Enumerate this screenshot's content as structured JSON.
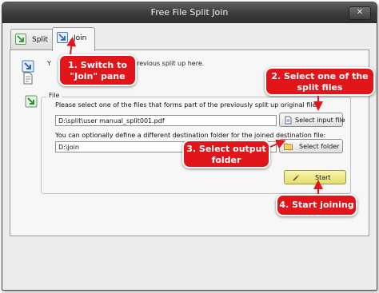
{
  "window": {
    "title": "Free File Split Join",
    "close_symbol": "✕"
  },
  "tabs": [
    {
      "label": "Split",
      "icon": "split-arrow-icon"
    },
    {
      "label": "Join",
      "icon": "join-arrow-icon"
    }
  ],
  "pane": {
    "intro_start": "Y",
    "intro_end": "revious split up here.",
    "group_title": "File",
    "select_desc": "Please select one of the files that forms part of the previously split up original file.",
    "input_file_value": "D:\\split\\user manual_split001.pdf",
    "select_input_label": "Select input file",
    "folder_desc": "You can optionally define a different destination folder for the joined destination file:",
    "output_folder_value": "D:\\join",
    "select_folder_label": "Select folder",
    "start_label": "Start"
  },
  "callouts": {
    "switch_tab": "1. Switch to \"Join\" pane",
    "select_file": "2. Select one of the split files",
    "output_folder": "3. Select output folder",
    "start": "4. Start joining"
  },
  "colors": {
    "callout_red": "#e0161b",
    "titlebar": "#3a3a3a",
    "start_button": "#ece67c",
    "icon_blue": "#3d7fd1",
    "icon_green": "#3a9a3a"
  }
}
